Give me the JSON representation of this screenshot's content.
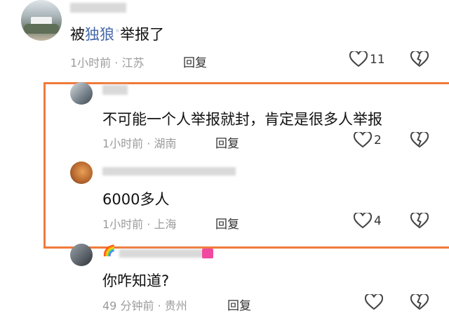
{
  "colors": {
    "highlight_border": "#f07a3a",
    "link": "#4468a8",
    "meta": "#9b9b9b"
  },
  "comments": [
    {
      "content_parts": [
        "被",
        "独狼",
        "举报了"
      ],
      "link_text": "独狼",
      "meta": "1小时前 · 江苏",
      "reply_label": "回复",
      "likes": "11"
    },
    {
      "content": "不可能一个人举报就封，肯定是很多人举报",
      "meta": "1小时前 · 湖南",
      "reply_label": "回复",
      "likes": "2"
    },
    {
      "content": "6000多人",
      "meta": "1小时前 · 上海",
      "reply_label": "回复",
      "likes": "4"
    },
    {
      "name_emoji": "🌈",
      "content": "你咋知道?",
      "meta": "49 分钟前 · 贵州",
      "reply_label": "回复",
      "likes": ""
    }
  ],
  "icons": {
    "like": "heart-outline-icon",
    "dislike": "broken-heart-icon",
    "search_hint": "search-icon"
  }
}
